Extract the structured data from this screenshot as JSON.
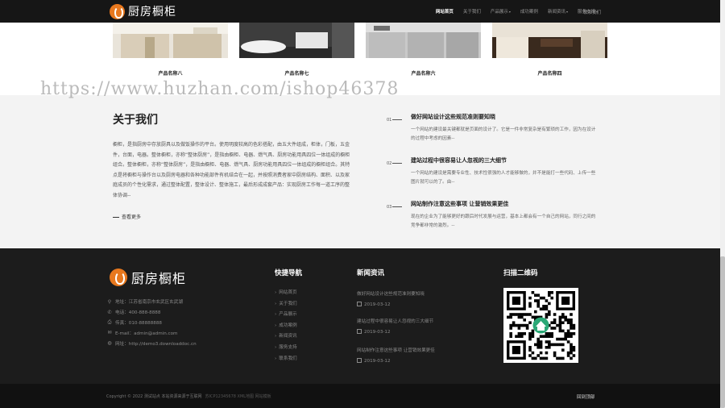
{
  "header": {
    "logo_text": "厨房橱柜",
    "nav": [
      {
        "label": "网站首页",
        "active": true,
        "dropdown": false
      },
      {
        "label": "关于我们",
        "active": false,
        "dropdown": false
      },
      {
        "label": "产品展示",
        "active": false,
        "dropdown": true
      },
      {
        "label": "成功案例",
        "active": false,
        "dropdown": false
      },
      {
        "label": "新闻资讯",
        "active": false,
        "dropdown": true
      },
      {
        "label": "服务支持",
        "active": false,
        "dropdown": true
      }
    ],
    "nav_last": "联系我们"
  },
  "products": [
    {
      "name": "产品名称八"
    },
    {
      "name": "产品名称七"
    },
    {
      "name": "产品名称六"
    },
    {
      "name": "产品名称四"
    }
  ],
  "watermark": "https://www.huzhan.com/ishop46378",
  "about": {
    "title": "关于我们",
    "text": "橱柜，是指厨房中存放厨具以及做饭操作的平台。使用明度较高的色彩搭配，由五大件组成，柜体，门板，五金件，台面，电器。整体橱柜，亦称“整体厨房”，是指由橱柜、电器、燃气具、厨房功能用具四位一体组成的橱柜组合。整体橱柜，亦称“整体厨房”，是指由橱柜、电器、燃气具、厨房功能用具四位一体组成的橱柜组合。其特点是将橱柜与操作台以及厨房电器和各种功能部件有机结合在一起，并按照消费者家中厨房结构、面积、以及家庭成员的个性化需求，通过整体配置，整体设计、整体施工，最后形成成套产品：实现厨房工作每一道工序的整体协调--",
    "more": "查看更多"
  },
  "news": [
    {
      "num": "01",
      "title": "做好网站设计这些规范准则要知晓",
      "desc": "一个网站的建设最关键都就是页面的设计了。它是一件非常复杂是有繁琐的工作，因为在设计的过程中考虑的因素--"
    },
    {
      "num": "02",
      "title": "建站过程中很容易让人忽视的三大细节",
      "desc": "一个网站的建设是需要专业性、技术性很强的人才能够做的，并不是能打一些代码、上传一些图片就可以的了。由--"
    },
    {
      "num": "03",
      "title": "网站制作注意这些事项 让营销效果更佳",
      "desc": "现在的企业为了能够更好的跟后时代发展与运营，基本上都会有一个自己的网站，同行之间的竞争都非常的激烈。--"
    }
  ],
  "footer": {
    "logo_text": "厨房橱柜",
    "contact": [
      {
        "icon": "map-pin-icon",
        "glyph": "⚲",
        "text": "地址：江苏省南京市玄武区玄武湖"
      },
      {
        "icon": "phone-icon",
        "glyph": "✆",
        "text": "电话：400-888-8888"
      },
      {
        "icon": "fax-icon",
        "glyph": "⎙",
        "text": "传真：010-88888888"
      },
      {
        "icon": "mail-icon",
        "glyph": "✉",
        "text": "E-mail：admin@admin.com"
      },
      {
        "icon": "globe-icon",
        "glyph": "◍",
        "text": "网址：http://demo3.downloaddoc.cn"
      }
    ],
    "quick_title": "快捷导航",
    "quick_links": [
      "网站首页",
      "关于我们",
      "产品展示",
      "成功案例",
      "新闻资讯",
      "服务支持",
      "联系我们"
    ],
    "news_title": "新闻资讯",
    "news": [
      {
        "title": "做好网站设计这些规范准则要知晓",
        "date": "2019-03-12"
      },
      {
        "title": "建站过程中很容易让人忽视的三大细节",
        "date": "2019-03-12"
      },
      {
        "title": "网站制作注意这些事项 让营销效果更佳",
        "date": "2019-03-12"
      }
    ],
    "qr_title": "扫描二维码"
  },
  "bottom": {
    "copyright": "Copyright © 2022 测试站点 本站资源来源于互联网",
    "icp": "苏ICP12345678 XML地图 网站模板",
    "back_top": "回到顶部"
  },
  "colors": {
    "accent": "#e8781e",
    "header_bg": "#161616",
    "footer_bg": "#1c1c1c"
  }
}
